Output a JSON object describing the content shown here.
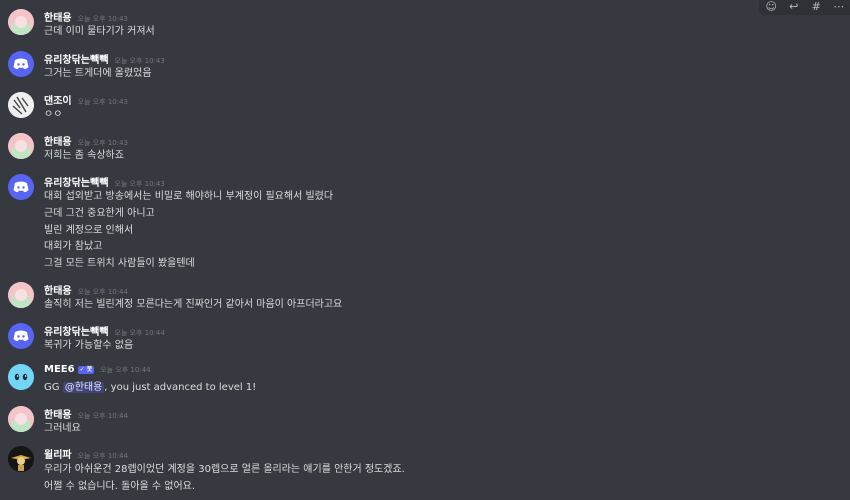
{
  "toolbar": {
    "icons": [
      "add-reaction-icon",
      "reply-icon",
      "thread-icon",
      "more-icon"
    ],
    "glyphs": [
      "☺",
      "↩",
      "#",
      "⋯"
    ]
  },
  "colors": {
    "background": "#36393f",
    "username": "#ffffff",
    "timestamp": "#72767d",
    "mention_bg": "#5865f2",
    "discord_blurple": "#5865f2"
  },
  "messages": [
    {
      "author": "한태용",
      "timestamp": "오늘 오후 10:43",
      "avatar": "green-default-avatar",
      "lines": [
        "근데 이미 물타기가 커져서"
      ]
    },
    {
      "author": "유리창닦는빽빽",
      "timestamp": "오늘 오후 10:43",
      "avatar": "discord-default-avatar",
      "lines": [
        "그거는 트게더에 올렸었음"
      ]
    },
    {
      "author": "댄조이",
      "timestamp": "오늘 오후 10:43",
      "avatar": "sketch-avatar",
      "lines": [
        "ㅇㅇ"
      ]
    },
    {
      "author": "한태용",
      "timestamp": "오늘 오후 10:43",
      "avatar": "green-default-avatar",
      "lines": [
        "저희는 좀 속상하죠"
      ]
    },
    {
      "author": "유리창닦는빽빽",
      "timestamp": "오늘 오후 10:43",
      "avatar": "discord-default-avatar",
      "lines": [
        "대회 섭외받고 방송에서는 비밀로 해야하니 부계정이 필요해서 빌렸다",
        "근데 그건 중요한게 아니고",
        "빌린 계정으로 인해서",
        "대회가 참났고",
        "그걸 모든 트위치 사람들이 봤을텐데"
      ]
    },
    {
      "author": "한태용",
      "timestamp": "오늘 오후 10:44",
      "avatar": "green-default-avatar",
      "lines": [
        "솔직히 저는 빌린계정 모른다는게 진짜인거 같아서 마음이 아프더라고요"
      ]
    },
    {
      "author": "유리창닦는빽빽",
      "timestamp": "오늘 오후 10:44",
      "avatar": "discord-default-avatar",
      "lines": [
        "복귀가 가능할수 없음"
      ]
    },
    {
      "author": "MEE6",
      "badge": "✓ 봇",
      "timestamp": "오늘 오후 10:44",
      "avatar": "mee6-avatar",
      "mention_prefix": "GG ",
      "mention": "@한태용",
      "mention_suffix": ", you just advanced to level 1!"
    },
    {
      "author": "한태용",
      "timestamp": "오늘 오후 10:44",
      "avatar": "green-default-avatar",
      "lines": [
        "그러네요"
      ]
    },
    {
      "author": "윌리파",
      "timestamp": "오늘 오후 10:44",
      "avatar": "willy-avatar",
      "lines": [
        "우리가 아쉬운건 28렙이었던 계정을 30렙으로 얼른 올리라는 얘기를 안한거 정도겠죠.",
        "어쩔 수 없습니다. 돌아올 수 없어요."
      ]
    }
  ]
}
